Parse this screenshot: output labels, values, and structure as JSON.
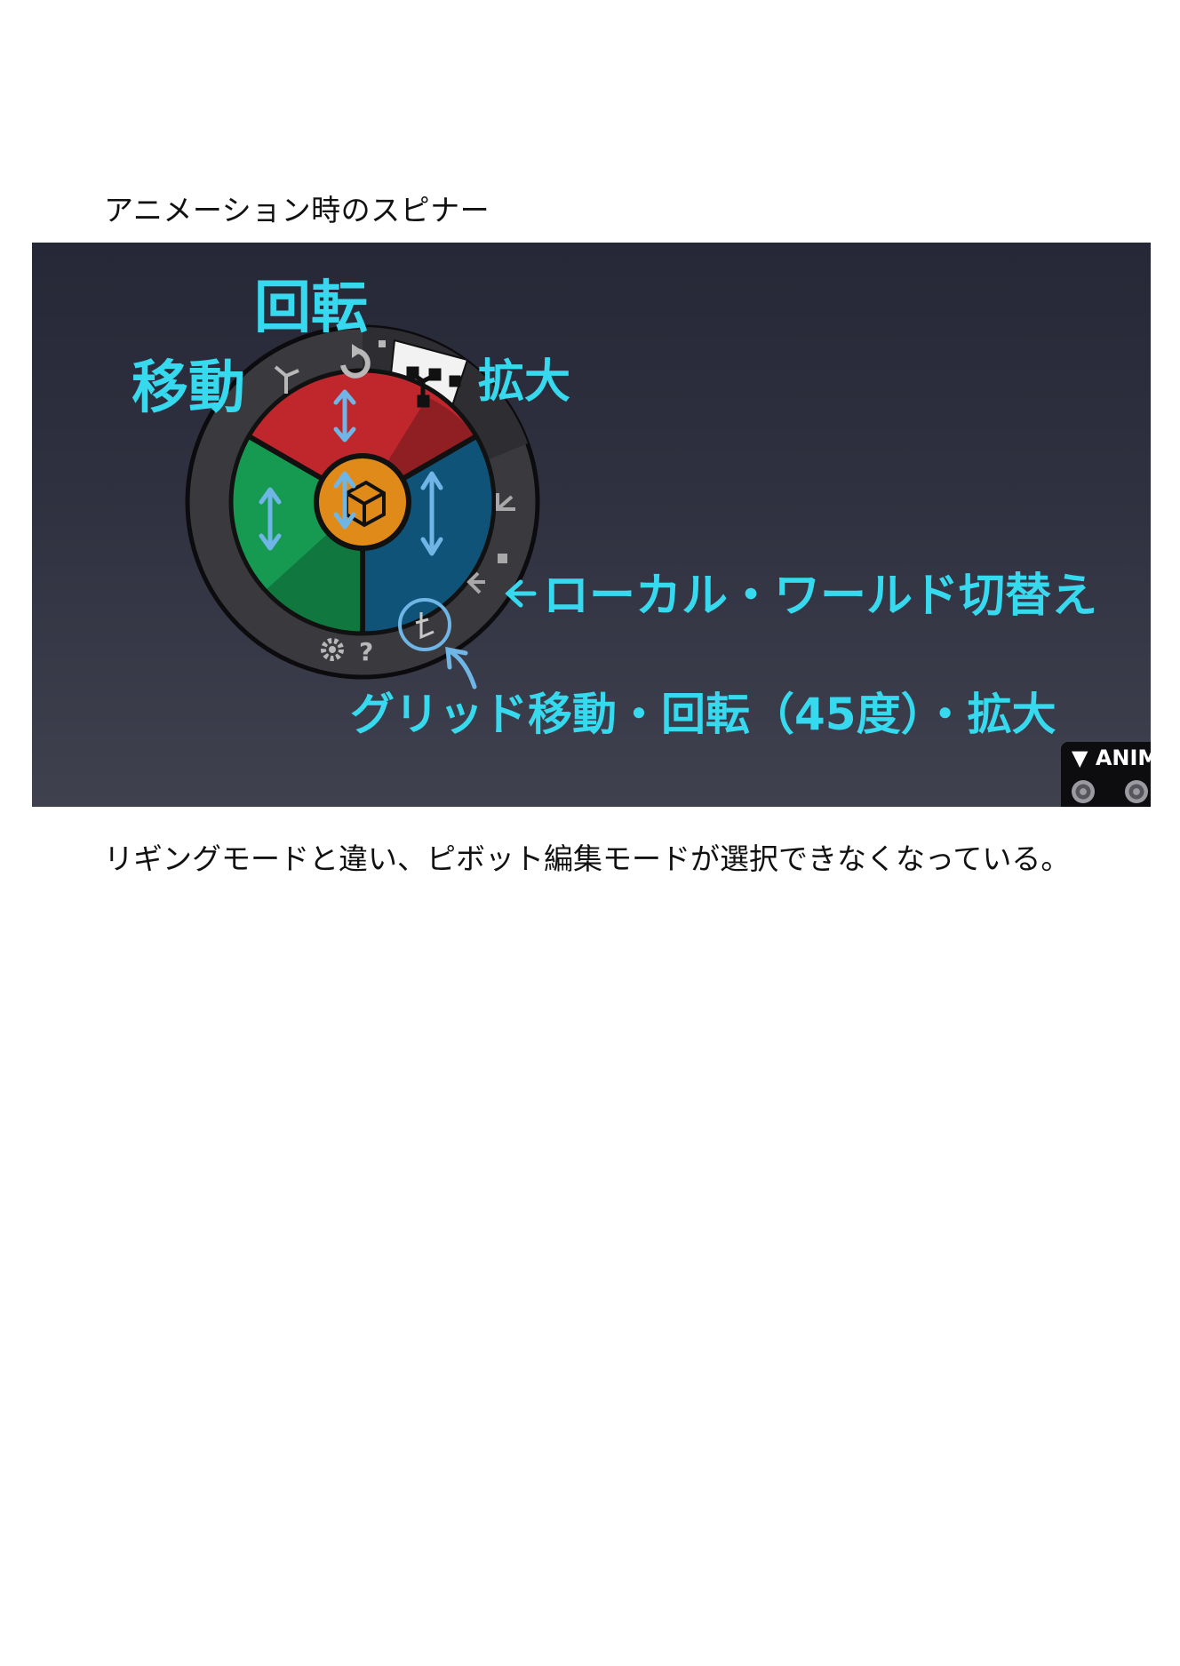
{
  "document": {
    "heading": "アニメーション時のスピナー",
    "caption": "リギングモードと違い、ピボット編集モードが選択できなくなっている。"
  },
  "annotations": {
    "rotate": "回転",
    "move": "移動",
    "scale": "拡大",
    "local_world": "ローカル・ワールド切替え",
    "grid": "グリッド移動・回転（45度）・拡大"
  },
  "panel": {
    "label": "▼ ANIM"
  },
  "spinner": {
    "help_symbol": "?"
  },
  "colors": {
    "annotation": "#36d9ee",
    "segment_top": "#c0272d",
    "segment_left": "#169a52",
    "segment_right": "#0f5478",
    "center_hub": "#e08a1a",
    "ring": "#3a3a3e"
  },
  "icons": [
    "move-axes-icon",
    "rotate-icon",
    "scale-axes-icon",
    "local-axis-icon",
    "world-axis-icon",
    "grid-snap-icon",
    "settings-gear-icon",
    "help-icon",
    "bounding-box-icon",
    "double-arrow-icon"
  ]
}
